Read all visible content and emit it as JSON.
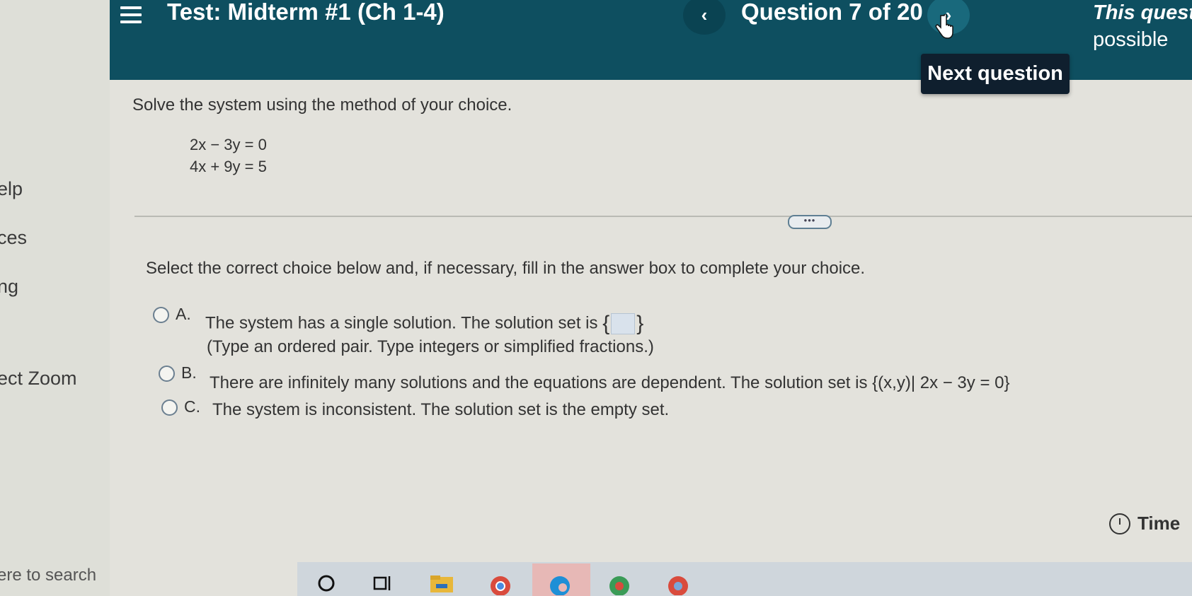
{
  "sidebar": {
    "items": [
      "elp",
      "ces",
      "ng",
      "ect Zoom"
    ],
    "search_text": "ere to search"
  },
  "header": {
    "menu_icon": "hamburger-menu-icon",
    "test_title": "Test: Midterm #1 (Ch 1-4)",
    "prev_label": "‹",
    "question_counter": "Question 7 of 20",
    "next_label": "›",
    "info_line1": "This questi",
    "info_line2": "possible",
    "tooltip": "Next question"
  },
  "question": {
    "prompt": "Solve the system using the method of your choice.",
    "equation1": "2x − 3y = 0",
    "equation2": "4x + 9y = 5",
    "more_label": "•••",
    "instruction": "Select the correct choice below and, if necessary, fill in the answer box to complete your choice."
  },
  "choices": [
    {
      "letter": "A.",
      "text": "The system has a single solution. The solution set is",
      "note": "(Type an ordered pair. Type integers or simplified fractions.)"
    },
    {
      "letter": "B.",
      "text": "There are infinitely many solutions and the equations are dependent. The solution set is",
      "set": "{(x,y)| 2x − 3y = 0}"
    },
    {
      "letter": "C.",
      "text": "The system is inconsistent. The solution set is the empty set."
    }
  ],
  "footer": {
    "time_label": "Time"
  },
  "colors": {
    "header_bg": "#0e4f60",
    "tooltip_bg": "#0f1f2e",
    "page_bg": "#e3e2dc"
  }
}
